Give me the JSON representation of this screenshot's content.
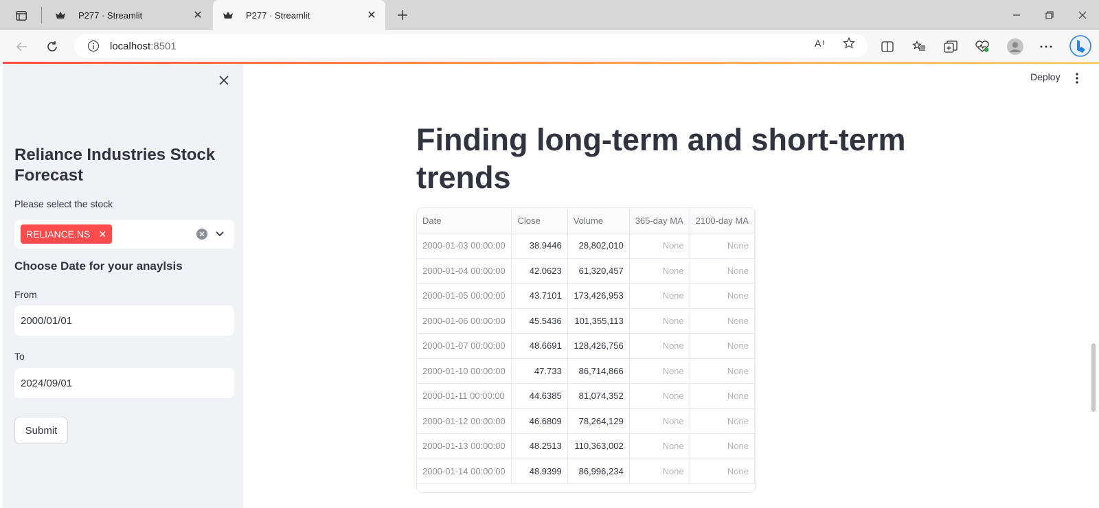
{
  "browser": {
    "tabs": [
      {
        "title": "P277 · Streamlit",
        "active": false
      },
      {
        "title": "P277 · Streamlit",
        "active": true
      }
    ],
    "url_host": "localhost",
    "url_port": ":8501"
  },
  "sidebar": {
    "title": "Reliance Industries Stock Forecast",
    "stock_label": "Please select the stock",
    "selected_stock": "RELIANCE.NS",
    "date_heading": "Choose Date for your anaylsis",
    "from_label": "From",
    "from_value": "2000/01/01",
    "to_label": "To",
    "to_value": "2024/09/01",
    "submit_label": "Submit"
  },
  "main": {
    "deploy_label": "Deploy",
    "heading": "Finding long-term and short-term trends",
    "table": {
      "columns": [
        "Date",
        "Close",
        "Volume",
        "365-day MA",
        "2100-day MA"
      ],
      "rows": [
        [
          "2000-01-03 00:00:00",
          "38.9446",
          "28,802,010",
          "None",
          "None"
        ],
        [
          "2000-01-04 00:00:00",
          "42.0623",
          "61,320,457",
          "None",
          "None"
        ],
        [
          "2000-01-05 00:00:00",
          "43.7101",
          "173,426,953",
          "None",
          "None"
        ],
        [
          "2000-01-06 00:00:00",
          "45.5436",
          "101,355,113",
          "None",
          "None"
        ],
        [
          "2000-01-07 00:00:00",
          "48.6691",
          "128,426,756",
          "None",
          "None"
        ],
        [
          "2000-01-10 00:00:00",
          "47.733",
          "86,714,866",
          "None",
          "None"
        ],
        [
          "2000-01-11 00:00:00",
          "44.6385",
          "81,074,352",
          "None",
          "None"
        ],
        [
          "2000-01-12 00:00:00",
          "46.6809",
          "78,264,129",
          "None",
          "None"
        ],
        [
          "2000-01-13 00:00:00",
          "48.2513",
          "110,363,002",
          "None",
          "None"
        ],
        [
          "2000-01-14 00:00:00",
          "48.9399",
          "86,996,234",
          "None",
          "None"
        ]
      ]
    }
  },
  "colors": {
    "accent": "#ff4b4b",
    "sidebar_bg": "#f0f2f6",
    "text": "#31333f"
  }
}
